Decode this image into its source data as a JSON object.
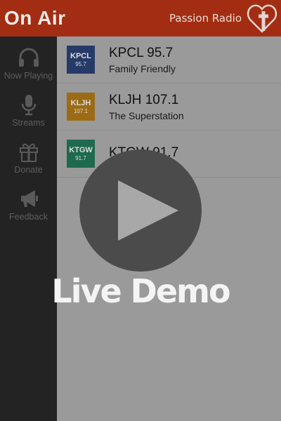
{
  "header": {
    "title": "On Air",
    "brand": "Passion Radio",
    "logo_icon": "heart-cross-logo-icon",
    "bg_color": "#a32d12"
  },
  "sidebar": {
    "items": [
      {
        "label": "Now Playing",
        "icon": "headphones-icon"
      },
      {
        "label": "Streams",
        "icon": "microphone-icon"
      },
      {
        "label": "Donate",
        "icon": "gift-icon"
      },
      {
        "label": "Feedback",
        "icon": "megaphone-icon"
      }
    ]
  },
  "stations": [
    {
      "call": "KPCL",
      "freq": "95.7",
      "name": "KPCL 95.7",
      "tagline": "Family Friendly",
      "color": "#253a67"
    },
    {
      "call": "KLJH",
      "freq": "107.1",
      "name": "KLJH 107.1",
      "tagline": "The Superstation",
      "color": "#9b6b16"
    },
    {
      "call": "KTGW",
      "freq": "91.7",
      "name": "KTGW 91.7",
      "tagline": "",
      "color": "#1e6a4f"
    }
  ],
  "overlay": {
    "play_icon": "play-icon",
    "label": "Live Demo"
  }
}
